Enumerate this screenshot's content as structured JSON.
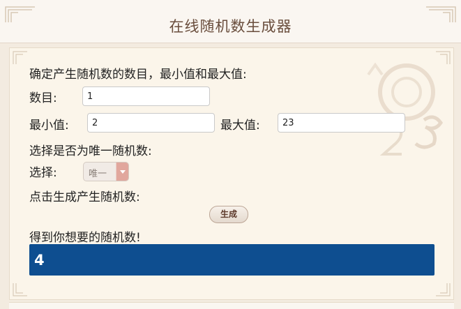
{
  "header": {
    "title": "在线随机数生成器"
  },
  "form": {
    "intro": "确定产生随机数的数目，最小值和最大值:",
    "count_label": "数目:",
    "count_value": "1",
    "min_label": "最小值:",
    "min_value": "2",
    "max_label": "最大值:",
    "max_value": "23",
    "unique_prompt": "选择是否为唯一随机数:",
    "select_label": "选择:",
    "select_value": "唯一",
    "generate_prompt": "点击生成产生随机数:",
    "generate_button": "生成",
    "result_prompt": "得到你想要的随机数!",
    "result_value": "4"
  },
  "colors": {
    "title": "#6a4e3d",
    "result_background": "#0e4e90",
    "select_arrow": "#e1a79d"
  }
}
